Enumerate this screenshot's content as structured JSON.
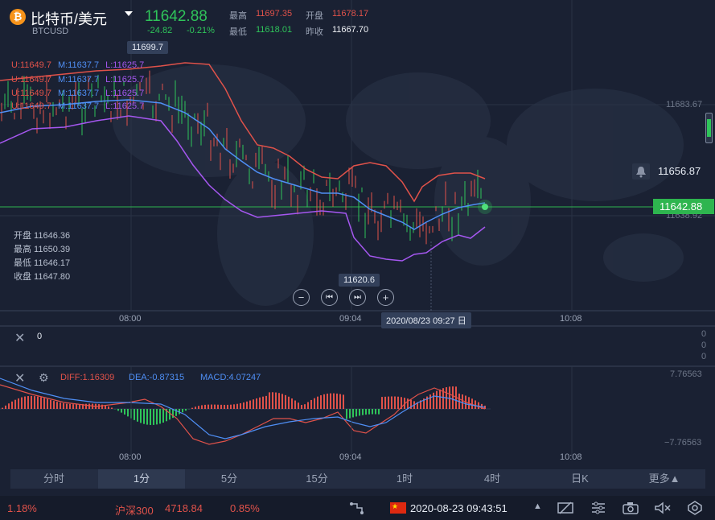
{
  "header": {
    "pair_name": "比特币/美元",
    "pair_code": "BTCUSD",
    "last_price": "11642.88",
    "change": "-24.82",
    "change_pct": "-0.21%",
    "high_label": "最高",
    "high": "11697.35",
    "open_label": "开盘",
    "open": "11678.17",
    "low_label": "最低",
    "low": "11618.01",
    "prev_close_label": "昨收",
    "prev_close": "11667.70"
  },
  "boll_legend": [
    {
      "u": "U:11649.7",
      "m": "M:11637.7",
      "l": "L:11625.7"
    },
    {
      "u": "U:11649.7",
      "m": "M:11637.7",
      "l": "L:11625.7"
    },
    {
      "u": "U:11649.7",
      "m": "M:11637.7",
      "l": "L:11625.7"
    },
    {
      "u": "U:11649.7",
      "m": "M:11637.7",
      "l": "L:11625.7"
    }
  ],
  "ohlc": {
    "open": "开盘 11646.36",
    "high": "最高 11650.39",
    "low": "最低 11646.17",
    "close": "收盘 11647.80"
  },
  "main_chart": {
    "max_tag": "11699.7",
    "min_tag": "11620.6",
    "price_axis": [
      "11683.67",
      "11638.92"
    ],
    "alert_price": "11656.87",
    "current_price": "11642.88",
    "time_axis": [
      "08:00",
      "09:04",
      "10:08"
    ],
    "crosshair_time": "2020/08/23 09:27 日",
    "controls": {
      "zoom_out": "−",
      "prev": "⏮",
      "next": "⏭",
      "zoom_in": "+"
    }
  },
  "volume_panel": {
    "value": "0",
    "axis": [
      "0",
      "0",
      "0"
    ]
  },
  "macd_panel": {
    "diff": "DIFF:1.16309",
    "dea": "DEA:-0.87315",
    "macd": "MACD:4.07247",
    "axis_top": "7.76563",
    "axis_bottom": "−7.76563",
    "time_axis": [
      "08:00",
      "09:04",
      "10:08"
    ]
  },
  "periods": [
    "分时",
    "1分",
    "5分",
    "15分",
    "1时",
    "4时",
    "日K",
    "更多▲"
  ],
  "active_period": "1分",
  "footer": {
    "left_pct": "1.18%",
    "index_name": "沪深300",
    "index_value": "4718.84",
    "index_pct": "0.85%",
    "datetime": "2020-08-23 09:43:51"
  },
  "colors": {
    "up": "#e0524a",
    "down": "#2fc45a",
    "mid": "#4f8ff5",
    "lower": "#a557f0",
    "bg": "#1a2133"
  },
  "icons": [
    "bitcoin-icon",
    "bell-icon",
    "close-icon",
    "gear-icon",
    "draw-icon",
    "china-flag-icon",
    "triangle-up-icon",
    "screen-icon",
    "settings-icon",
    "camera-icon",
    "mute-icon",
    "eye-icon"
  ]
}
